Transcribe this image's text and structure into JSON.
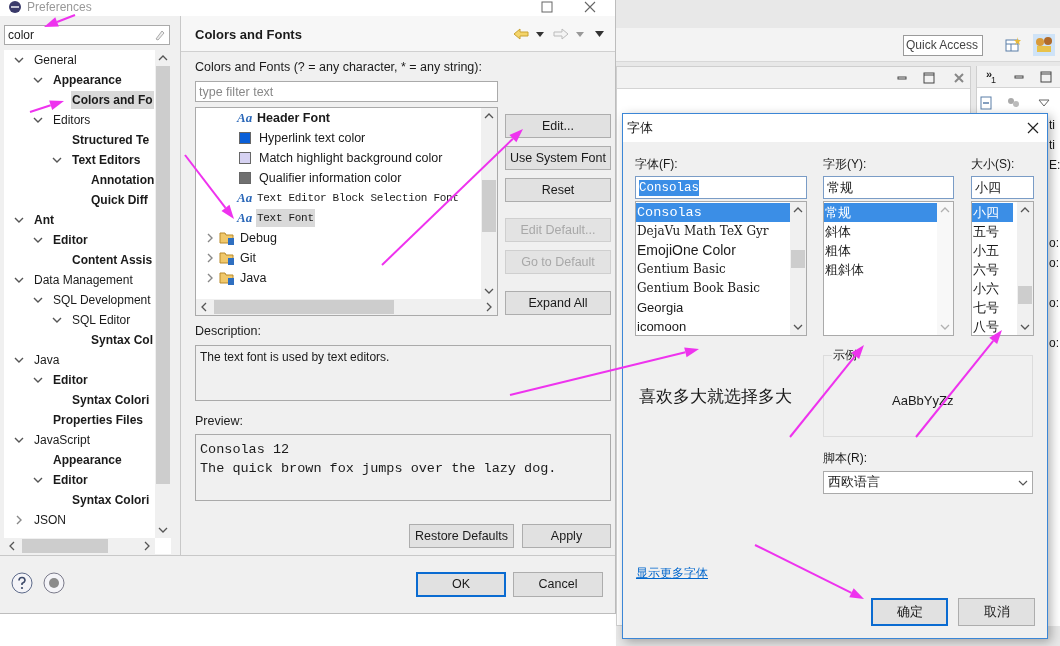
{
  "preferences": {
    "title": "Preferences",
    "filter": "color",
    "tree": [
      {
        "label": "General",
        "bold": false,
        "selected": false,
        "expanded": true,
        "children": [
          {
            "label": "Appearance",
            "bold": true,
            "selected": false,
            "expanded": true,
            "children": [
              {
                "label": "Colors and Fo",
                "bold": true,
                "selected": true
              }
            ]
          },
          {
            "label": "Editors",
            "bold": false,
            "selected": false,
            "expanded": true,
            "children": [
              {
                "label": "Structured Te",
                "bold": true,
                "selected": false
              },
              {
                "label": "Text Editors",
                "bold": true,
                "selected": false,
                "expanded": true,
                "children": [
                  {
                    "label": "Annotation",
                    "bold": true,
                    "selected": false
                  },
                  {
                    "label": "Quick Diff",
                    "bold": true,
                    "selected": false
                  }
                ]
              }
            ]
          }
        ]
      },
      {
        "label": "Ant",
        "bold": true,
        "selected": false,
        "expanded": true,
        "children": [
          {
            "label": "Editor",
            "bold": true,
            "selected": false,
            "expanded": true,
            "children": [
              {
                "label": "Content Assis",
                "bold": true,
                "selected": false
              }
            ]
          }
        ]
      },
      {
        "label": "Data Management",
        "bold": false,
        "selected": false,
        "expanded": true,
        "children": [
          {
            "label": "SQL Development",
            "bold": false,
            "selected": false,
            "expanded": true,
            "children": [
              {
                "label": "SQL Editor",
                "bold": false,
                "selected": false,
                "expanded": true,
                "children": [
                  {
                    "label": "Syntax Col",
                    "bold": true,
                    "selected": false
                  }
                ]
              }
            ]
          }
        ]
      },
      {
        "label": "Java",
        "bold": false,
        "selected": false,
        "expanded": true,
        "children": [
          {
            "label": "Editor",
            "bold": true,
            "selected": false,
            "expanded": true,
            "children": [
              {
                "label": "Syntax Colori",
                "bold": true,
                "selected": false
              }
            ]
          },
          {
            "label": "Properties Files",
            "bold": true,
            "selected": false
          }
        ]
      },
      {
        "label": "JavaScript",
        "bold": false,
        "selected": false,
        "expanded": true,
        "children": [
          {
            "label": "Appearance",
            "bold": true,
            "selected": false
          },
          {
            "label": "Editor",
            "bold": true,
            "selected": false,
            "expanded": true,
            "children": [
              {
                "label": "Syntax Colori",
                "bold": true,
                "selected": false
              }
            ]
          }
        ]
      },
      {
        "label": "JSON",
        "bold": false,
        "selected": false,
        "expanded": false
      }
    ],
    "page": {
      "title": "Colors and Fonts",
      "filter_label": "Colors and Fonts (? = any character, * = any string):",
      "filter_placeholder": "type filter text",
      "items": [
        {
          "kind": "font",
          "icon": "Aa",
          "label": "Header Font",
          "bold": true,
          "mono": false,
          "selected": false
        },
        {
          "kind": "color",
          "color": "#0a5fd8",
          "label": "Hyperlink text color",
          "bold": false,
          "mono": false,
          "selected": false
        },
        {
          "kind": "color",
          "color": "#d6d2f2",
          "label": "Match highlight background color",
          "bold": false,
          "mono": false,
          "selected": false
        },
        {
          "kind": "color",
          "color": "#707070",
          "label": "Qualifier information color",
          "bold": false,
          "mono": false,
          "selected": false
        },
        {
          "kind": "font",
          "icon": "Aa",
          "label": "Text Editor Block Selection Font",
          "bold": false,
          "mono": true,
          "selected": false
        },
        {
          "kind": "font",
          "icon": "Aa",
          "label": "Text Font",
          "bold": false,
          "mono": true,
          "selected": true
        },
        {
          "kind": "category",
          "label": "Debug",
          "bold": false,
          "mono": false,
          "selected": false,
          "expanded": false
        },
        {
          "kind": "category",
          "label": "Git",
          "bold": false,
          "mono": false,
          "selected": false,
          "expanded": false
        },
        {
          "kind": "category",
          "label": "Java",
          "bold": false,
          "mono": false,
          "selected": false,
          "expanded": false
        }
      ],
      "buttons": [
        {
          "label": "Edit...",
          "disabled": false
        },
        {
          "label": "Use System Font",
          "disabled": false
        },
        {
          "label": "Reset",
          "disabled": false
        },
        {
          "label": "Edit Default...",
          "disabled": true
        },
        {
          "label": "Go to Default",
          "disabled": true
        },
        {
          "label": "Expand All",
          "disabled": false
        }
      ],
      "description_label": "Description:",
      "description": "The text font is used by text editors.",
      "preview_label": "Preview:",
      "preview_lines": [
        "Consolas 12",
        "The quick brown fox jumps over the lazy dog."
      ],
      "page_buttons": [
        "Restore Defaults",
        "Apply"
      ]
    },
    "dialog_buttons": [
      {
        "label": "OK",
        "default": true
      },
      {
        "label": "Cancel",
        "default": false
      }
    ]
  },
  "font_dialog": {
    "title": "字体",
    "columns": [
      {
        "label": "字体(F):",
        "value": "Consolas",
        "items": [
          {
            "label": "Consolas",
            "kind": "mono",
            "selected": true
          },
          {
            "label": "DejaVu Math TeX Gyr",
            "kind": "serif",
            "selected": false
          },
          {
            "label": "EmojiOne Color",
            "kind": "sans",
            "selected": false
          },
          {
            "label": "Gentium Basic",
            "kind": "serif",
            "selected": false
          },
          {
            "label": "Gentium Book Basic",
            "kind": "serif",
            "selected": false
          },
          {
            "label": "Georgia",
            "kind": "sans",
            "selected": false
          },
          {
            "label": "icomoon",
            "kind": "sans",
            "selected": false
          }
        ]
      },
      {
        "label": "字形(Y):",
        "value": "常规",
        "items": [
          {
            "label": "常规",
            "kind": "sans",
            "selected": true
          },
          {
            "label": "斜体",
            "kind": "sans",
            "selected": false
          },
          {
            "label": "粗体",
            "kind": "sans",
            "selected": false
          },
          {
            "label": "粗斜体",
            "kind": "sans",
            "selected": false
          }
        ]
      },
      {
        "label": "大小(S):",
        "value": "小四",
        "items": [
          {
            "label": "小四",
            "kind": "sans",
            "selected": true
          },
          {
            "label": "五号",
            "kind": "sans",
            "selected": false
          },
          {
            "label": "小五",
            "kind": "sans",
            "selected": false
          },
          {
            "label": "六号",
            "kind": "sans",
            "selected": false
          },
          {
            "label": "小六",
            "kind": "sans",
            "selected": false
          },
          {
            "label": "七号",
            "kind": "sans",
            "selected": false
          },
          {
            "label": "八号",
            "kind": "sans",
            "selected": false
          }
        ]
      }
    ],
    "sample_label": "示例",
    "sample_text": "AaBbYyZz",
    "script_label": "脚本(R):",
    "script_value": "西欧语言",
    "more_fonts_link": "显示更多字体",
    "buttons": [
      {
        "label": "确定",
        "default": true
      },
      {
        "label": "取消",
        "default": false
      }
    ]
  },
  "annotation": {
    "note": "喜欢多大就选择多大"
  },
  "workbench": {
    "quick_access": "Quick Access",
    "overflow_icon": "»",
    "view_count": "1",
    "fragments": [
      "ti",
      "ti",
      "E:",
      "o:",
      "o:",
      "o:",
      "o:"
    ]
  }
}
